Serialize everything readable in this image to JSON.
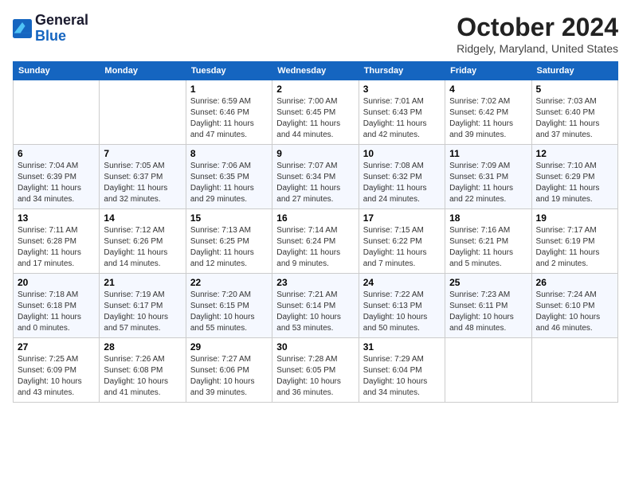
{
  "logo": {
    "line1": "General",
    "line2": "Blue"
  },
  "title": "October 2024",
  "subtitle": "Ridgely, Maryland, United States",
  "weekdays": [
    "Sunday",
    "Monday",
    "Tuesday",
    "Wednesday",
    "Thursday",
    "Friday",
    "Saturday"
  ],
  "weeks": [
    [
      {
        "day": "",
        "info": ""
      },
      {
        "day": "",
        "info": ""
      },
      {
        "day": "1",
        "info": "Sunrise: 6:59 AM\nSunset: 6:46 PM\nDaylight: 11 hours and 47 minutes."
      },
      {
        "day": "2",
        "info": "Sunrise: 7:00 AM\nSunset: 6:45 PM\nDaylight: 11 hours and 44 minutes."
      },
      {
        "day": "3",
        "info": "Sunrise: 7:01 AM\nSunset: 6:43 PM\nDaylight: 11 hours and 42 minutes."
      },
      {
        "day": "4",
        "info": "Sunrise: 7:02 AM\nSunset: 6:42 PM\nDaylight: 11 hours and 39 minutes."
      },
      {
        "day": "5",
        "info": "Sunrise: 7:03 AM\nSunset: 6:40 PM\nDaylight: 11 hours and 37 minutes."
      }
    ],
    [
      {
        "day": "6",
        "info": "Sunrise: 7:04 AM\nSunset: 6:39 PM\nDaylight: 11 hours and 34 minutes."
      },
      {
        "day": "7",
        "info": "Sunrise: 7:05 AM\nSunset: 6:37 PM\nDaylight: 11 hours and 32 minutes."
      },
      {
        "day": "8",
        "info": "Sunrise: 7:06 AM\nSunset: 6:35 PM\nDaylight: 11 hours and 29 minutes."
      },
      {
        "day": "9",
        "info": "Sunrise: 7:07 AM\nSunset: 6:34 PM\nDaylight: 11 hours and 27 minutes."
      },
      {
        "day": "10",
        "info": "Sunrise: 7:08 AM\nSunset: 6:32 PM\nDaylight: 11 hours and 24 minutes."
      },
      {
        "day": "11",
        "info": "Sunrise: 7:09 AM\nSunset: 6:31 PM\nDaylight: 11 hours and 22 minutes."
      },
      {
        "day": "12",
        "info": "Sunrise: 7:10 AM\nSunset: 6:29 PM\nDaylight: 11 hours and 19 minutes."
      }
    ],
    [
      {
        "day": "13",
        "info": "Sunrise: 7:11 AM\nSunset: 6:28 PM\nDaylight: 11 hours and 17 minutes."
      },
      {
        "day": "14",
        "info": "Sunrise: 7:12 AM\nSunset: 6:26 PM\nDaylight: 11 hours and 14 minutes."
      },
      {
        "day": "15",
        "info": "Sunrise: 7:13 AM\nSunset: 6:25 PM\nDaylight: 11 hours and 12 minutes."
      },
      {
        "day": "16",
        "info": "Sunrise: 7:14 AM\nSunset: 6:24 PM\nDaylight: 11 hours and 9 minutes."
      },
      {
        "day": "17",
        "info": "Sunrise: 7:15 AM\nSunset: 6:22 PM\nDaylight: 11 hours and 7 minutes."
      },
      {
        "day": "18",
        "info": "Sunrise: 7:16 AM\nSunset: 6:21 PM\nDaylight: 11 hours and 5 minutes."
      },
      {
        "day": "19",
        "info": "Sunrise: 7:17 AM\nSunset: 6:19 PM\nDaylight: 11 hours and 2 minutes."
      }
    ],
    [
      {
        "day": "20",
        "info": "Sunrise: 7:18 AM\nSunset: 6:18 PM\nDaylight: 11 hours and 0 minutes."
      },
      {
        "day": "21",
        "info": "Sunrise: 7:19 AM\nSunset: 6:17 PM\nDaylight: 10 hours and 57 minutes."
      },
      {
        "day": "22",
        "info": "Sunrise: 7:20 AM\nSunset: 6:15 PM\nDaylight: 10 hours and 55 minutes."
      },
      {
        "day": "23",
        "info": "Sunrise: 7:21 AM\nSunset: 6:14 PM\nDaylight: 10 hours and 53 minutes."
      },
      {
        "day": "24",
        "info": "Sunrise: 7:22 AM\nSunset: 6:13 PM\nDaylight: 10 hours and 50 minutes."
      },
      {
        "day": "25",
        "info": "Sunrise: 7:23 AM\nSunset: 6:11 PM\nDaylight: 10 hours and 48 minutes."
      },
      {
        "day": "26",
        "info": "Sunrise: 7:24 AM\nSunset: 6:10 PM\nDaylight: 10 hours and 46 minutes."
      }
    ],
    [
      {
        "day": "27",
        "info": "Sunrise: 7:25 AM\nSunset: 6:09 PM\nDaylight: 10 hours and 43 minutes."
      },
      {
        "day": "28",
        "info": "Sunrise: 7:26 AM\nSunset: 6:08 PM\nDaylight: 10 hours and 41 minutes."
      },
      {
        "day": "29",
        "info": "Sunrise: 7:27 AM\nSunset: 6:06 PM\nDaylight: 10 hours and 39 minutes."
      },
      {
        "day": "30",
        "info": "Sunrise: 7:28 AM\nSunset: 6:05 PM\nDaylight: 10 hours and 36 minutes."
      },
      {
        "day": "31",
        "info": "Sunrise: 7:29 AM\nSunset: 6:04 PM\nDaylight: 10 hours and 34 minutes."
      },
      {
        "day": "",
        "info": ""
      },
      {
        "day": "",
        "info": ""
      }
    ]
  ]
}
